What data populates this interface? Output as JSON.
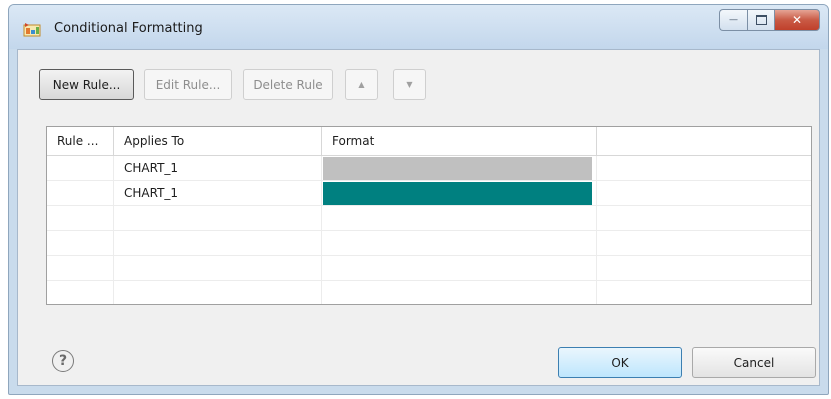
{
  "window": {
    "title": "Conditional Formatting",
    "minimize_symbol": "—",
    "maximize_symbol": "▫",
    "close_symbol": "✕"
  },
  "toolbar": {
    "new_rule": "New Rule...",
    "edit_rule": "Edit Rule...",
    "delete_rule": "Delete Rule",
    "move_up_symbol": "▲",
    "move_down_symbol": "▼"
  },
  "table": {
    "columns": [
      "Rule ...",
      "Applies To",
      "Format",
      ""
    ],
    "rows": [
      {
        "rule": "",
        "applies_to": "CHART_1",
        "format_color": "#c0c0c0"
      },
      {
        "rule": "",
        "applies_to": "CHART_1",
        "format_color": "#008080"
      }
    ]
  },
  "footer": {
    "help_symbol": "?",
    "ok": "OK",
    "cancel": "Cancel"
  },
  "icons": {
    "app": "conditional-formatting-icon",
    "help": "help-icon",
    "up": "arrow-up-icon",
    "down": "arrow-down-icon"
  }
}
